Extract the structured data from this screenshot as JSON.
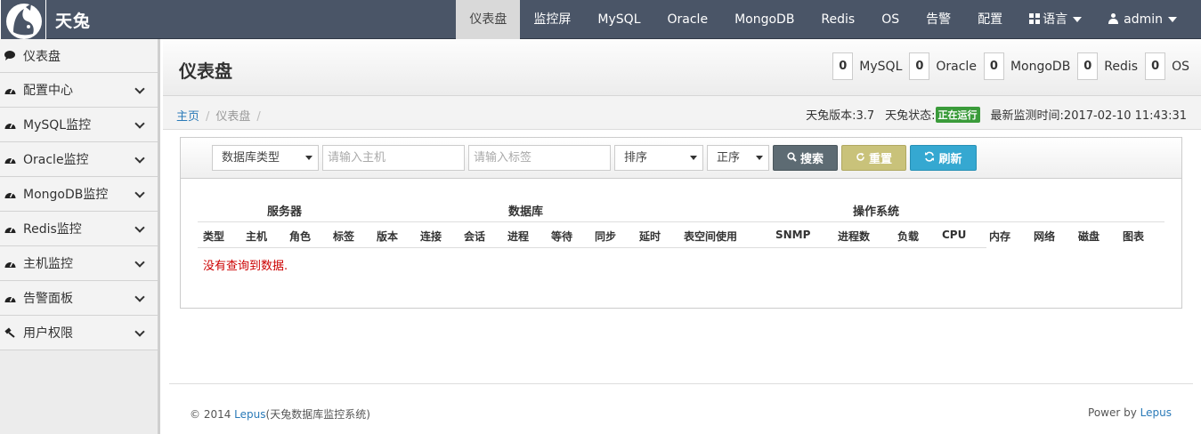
{
  "app": {
    "name": "天兔"
  },
  "nav": {
    "items": [
      "仪表盘",
      "监控屏",
      "MySQL",
      "Oracle",
      "MongoDB",
      "Redis",
      "OS",
      "告警",
      "配置"
    ],
    "language": "语言",
    "user": "admin"
  },
  "sidebar": {
    "items": [
      {
        "label": "仪表盘",
        "icon": "comment-icon"
      },
      {
        "label": "配置中心",
        "icon": "dashboard-icon"
      },
      {
        "label": "MySQL监控",
        "icon": "dashboard-icon"
      },
      {
        "label": "Oracle监控",
        "icon": "dashboard-icon"
      },
      {
        "label": "MongoDB监控",
        "icon": "dashboard-icon"
      },
      {
        "label": "Redis监控",
        "icon": "dashboard-icon"
      },
      {
        "label": "主机监控",
        "icon": "dashboard-icon"
      },
      {
        "label": "告警面板",
        "icon": "dashboard-icon"
      },
      {
        "label": "用户权限",
        "icon": "gavel-icon"
      }
    ]
  },
  "header": {
    "title": "仪表盘",
    "stats": [
      {
        "count": "0",
        "label": "MySQL"
      },
      {
        "count": "0",
        "label": "Oracle"
      },
      {
        "count": "0",
        "label": "MongoDB"
      },
      {
        "count": "0",
        "label": "Redis"
      },
      {
        "count": "0",
        "label": "OS"
      }
    ]
  },
  "breadcrumb": {
    "home": "主页",
    "current": "仪表盘",
    "sep": "/"
  },
  "status": {
    "version_label": "天兔版本:3.7",
    "state_label": "天兔状态:",
    "state_badge": "正在运行",
    "time_label": "最新监测时间:2017-02-10 11:43:31"
  },
  "filter": {
    "db_type": "数据库类型",
    "host_placeholder": "请输入主机",
    "tag_placeholder": "请输入标签",
    "sort": "排序",
    "order": "正序",
    "search": "搜索",
    "reset": "重置",
    "refresh": "刷新"
  },
  "table": {
    "groups": [
      "服务器",
      "数据库",
      "操作系统"
    ],
    "columns": [
      "类型",
      "主机",
      "角色",
      "标签",
      "版本",
      "连接",
      "会话",
      "进程",
      "等待",
      "同步",
      "延时",
      "表空间使用",
      "SNMP",
      "进程数",
      "负载",
      "CPU",
      "内存",
      "网络",
      "磁盘",
      "图表"
    ],
    "empty": "没有查询到数据."
  },
  "footer": {
    "copy_prefix": "© 2014 ",
    "copy_link": "Lepus",
    "copy_suffix": "(天兔数据库监控系统)",
    "power_prefix": "Power by ",
    "power_link": "Lepus"
  },
  "colors": {
    "topbar": "#4a5567",
    "running": "#3a9b3a",
    "link": "#2a7ab8",
    "search_btn": "#5d6b73",
    "reset_btn": "#c9c27a",
    "refresh_btn": "#35a8d1"
  }
}
